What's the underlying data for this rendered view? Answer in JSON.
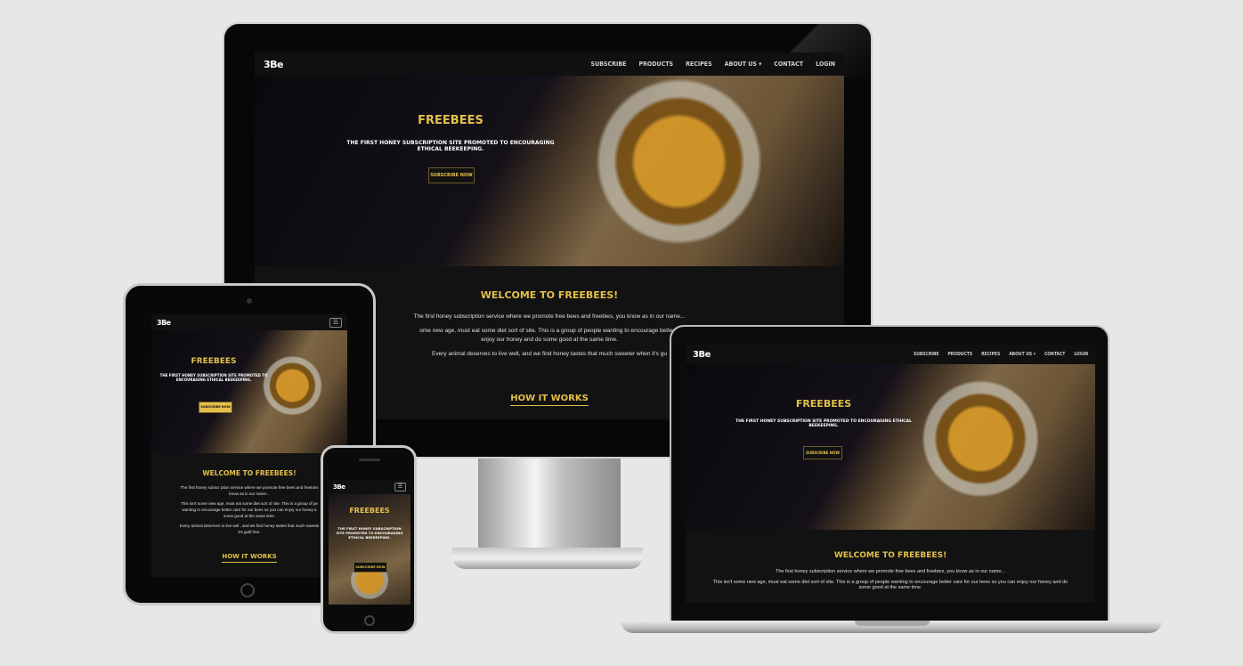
{
  "site": {
    "logo": "3Be",
    "nav": [
      "Subscribe",
      "Products",
      "Recipes",
      "About Us ▾",
      "Contact",
      "Login"
    ],
    "hero_title": "Freebees",
    "hero_subtitle": "The first honey subscription site promoted to encouraging ethical beekeeping.",
    "hero_button": "Subscribe Now",
    "welcome_title": "Welcome to Freebees!",
    "welcome_p1": "The first honey subscription service where we promote free bees and freebies, you know as in our name...",
    "welcome_p2": "This isn't some new age, must eat some diet sort of site. This is a group of people wanting to encourage better care for our bees so you can enjoy our honey and do some good at the same time.",
    "welcome_p3": "Every animal deserves to live well, and we find honey tastes that much sweeter when it's guilt free.",
    "how_it_works": "How it works"
  },
  "monitor": {
    "p2_visible": "ome new age, must eat some diet sort of site. This is a group of people wanting to encourage better c",
    "p2_line2": "enjoy our honey and do some good at the same time.",
    "p3_visible": "Every animal deserves to live well, and we find honey tastes that much sweeter when it's gu"
  },
  "tablet": {
    "p1": "The first honey subscr ption service where we promote free bees and freebies",
    "p1b": "know as in our name...",
    "p2": "This isn't some new age, must eat some diet sort of site. This is a group of pe",
    "p2b": "wanting to encourage better care for our bees so you can enjoy our honey a",
    "p2c": "some good at the same time.",
    "p3": "Every animal deserves to live wel , and we find honey tastes that much sweete",
    "p3b": "it's guilt free."
  },
  "colors": {
    "accent": "#e3c04b",
    "background": "#e7e7e7",
    "site_bg": "#121212"
  }
}
